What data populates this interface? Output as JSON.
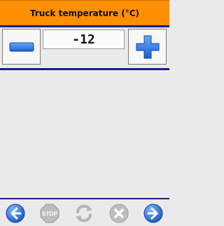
{
  "header": {
    "title": "Truck temperature (°C)"
  },
  "stepper": {
    "value": "-12",
    "decrement_icon": "minus-icon",
    "increment_icon": "plus-icon"
  },
  "footer": {
    "buttons": [
      {
        "icon": "back-arrow-icon",
        "enabled": true
      },
      {
        "icon": "stop-icon",
        "label": "STOP",
        "enabled": false
      },
      {
        "icon": "refresh-icon",
        "enabled": false
      },
      {
        "icon": "cancel-icon",
        "enabled": false
      },
      {
        "icon": "forward-arrow-icon",
        "enabled": true
      }
    ]
  },
  "colors": {
    "header": "#ff8f00",
    "rule": "#1d1f86",
    "icon_blue": "#1c6fd6",
    "disabled": "#b5b5b5",
    "background": "#eaeaea"
  }
}
